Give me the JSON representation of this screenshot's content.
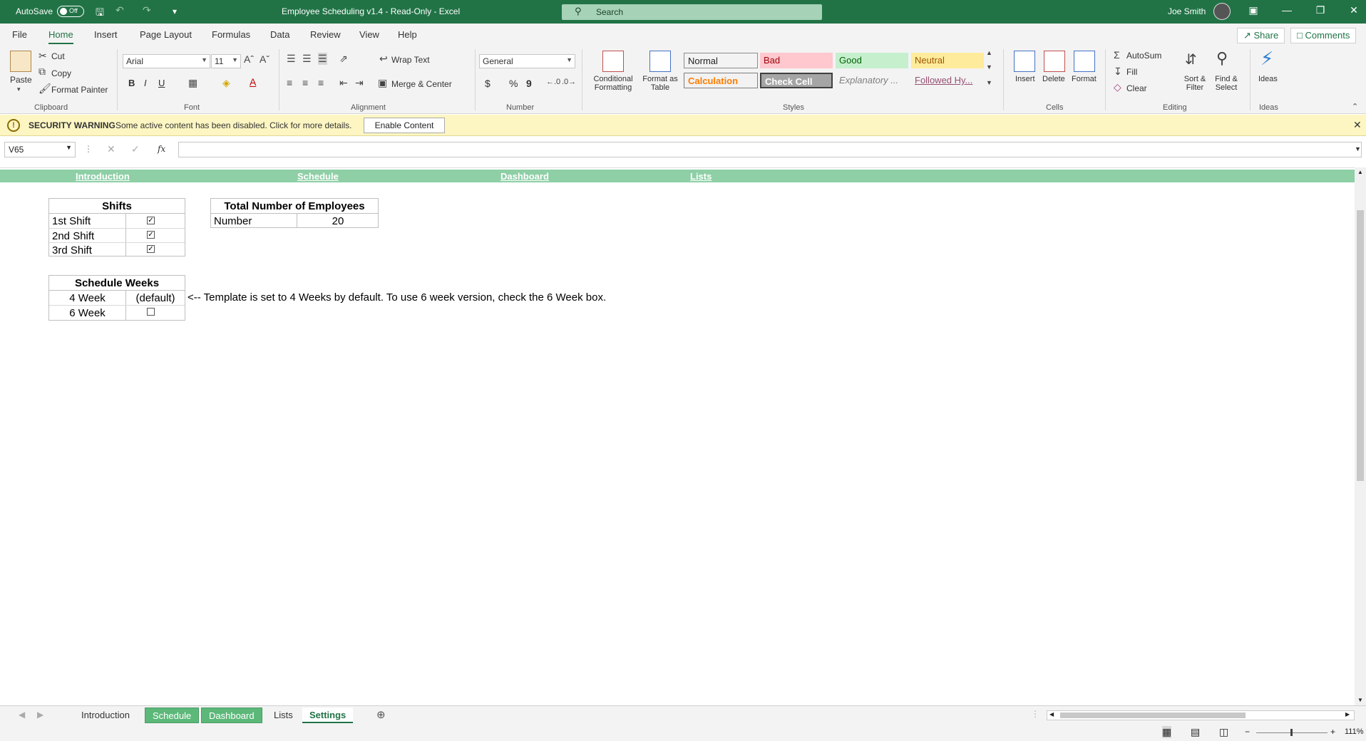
{
  "titlebar": {
    "autosave_label": "AutoSave",
    "autosave_state": "Off",
    "document_title": "Employee Scheduling v1.4  -  Read-Only  -  Excel",
    "search_placeholder": "Search",
    "user_name": "Joe Smith"
  },
  "ribbon_tabs": [
    "File",
    "Home",
    "Insert",
    "Page Layout",
    "Formulas",
    "Data",
    "Review",
    "View",
    "Help"
  ],
  "ribbon_actions": {
    "share": "Share",
    "comments": "Comments"
  },
  "clipboard": {
    "paste": "Paste",
    "cut": "Cut",
    "copy": "Copy",
    "format_painter": "Format Painter",
    "group": "Clipboard"
  },
  "font": {
    "name": "Arial",
    "size": "11",
    "bold": "B",
    "italic": "I",
    "underline": "U",
    "group": "Font"
  },
  "alignment": {
    "wrap_text": "Wrap Text",
    "merge_center": "Merge & Center",
    "group": "Alignment"
  },
  "number": {
    "format": "General",
    "currency": "$",
    "percent": "%",
    "comma": "9",
    "group": "Number"
  },
  "styles": {
    "conditional_formatting": "Conditional Formatting",
    "format_as_table": "Format as Table",
    "cells": [
      {
        "label": "Normal",
        "bg": "#ffffff",
        "fg": "#000000"
      },
      {
        "label": "Bad",
        "bg": "#ffc7ce",
        "fg": "#9c0006"
      },
      {
        "label": "Good",
        "bg": "#c6efce",
        "fg": "#006100"
      },
      {
        "label": "Neutral",
        "bg": "#ffeb9c",
        "fg": "#9c5700"
      },
      {
        "label": "Calculation",
        "bg": "#f2f2f2",
        "fg": "#fa7d00"
      },
      {
        "label": "Check Cell",
        "bg": "#a5a5a5",
        "fg": "#ffffff"
      },
      {
        "label": "Explanatory ...",
        "bg": "#ffffff",
        "fg": "#7f7f7f"
      },
      {
        "label": "Followed Hy...",
        "bg": "#ffffff",
        "fg": "#954f72"
      }
    ],
    "group": "Styles"
  },
  "cells_group": {
    "insert": "Insert",
    "delete": "Delete",
    "format": "Format",
    "group": "Cells"
  },
  "editing": {
    "autosum": "AutoSum",
    "fill": "Fill",
    "clear": "Clear",
    "sort_filter": "Sort & Filter",
    "find_select": "Find & Select",
    "group": "Editing"
  },
  "ideas": {
    "label": "Ideas",
    "group": "Ideas"
  },
  "security": {
    "title": "SECURITY WARNING",
    "message": "Some active content has been disabled. Click for more details.",
    "button": "Enable Content"
  },
  "formula_bar": {
    "name_box": "V65",
    "fx": "fx",
    "value": ""
  },
  "sheet": {
    "nav_links": [
      "Introduction",
      "Schedule",
      "Dashboard",
      "Lists"
    ],
    "shifts": {
      "header": "Shifts",
      "rows": [
        {
          "label": "1st Shift",
          "checked": true
        },
        {
          "label": "2nd Shift",
          "checked": true
        },
        {
          "label": "3rd Shift",
          "checked": true
        }
      ]
    },
    "employees": {
      "header": "Total Number of Employees",
      "label": "Number",
      "value": "20"
    },
    "schedule_weeks": {
      "header": "Schedule Weeks",
      "row1_label": "4 Week",
      "row1_value": "(default)",
      "row2_label": "6 Week",
      "row2_checked": false,
      "note": "<-- Template is set to 4 Weeks by default. To use 6 week version, check the 6 Week box."
    }
  },
  "sheet_tabs": [
    {
      "label": "Introduction",
      "style": "plain"
    },
    {
      "label": "Schedule",
      "style": "green"
    },
    {
      "label": "Dashboard",
      "style": "green"
    },
    {
      "label": "Lists",
      "style": "plain"
    },
    {
      "label": "Settings",
      "style": "active"
    }
  ],
  "status": {
    "zoom": "111%"
  },
  "colors": {
    "excel_green": "#217346",
    "nav_bar": "#8ecfa6",
    "warning_bg": "#fdf6c3"
  }
}
